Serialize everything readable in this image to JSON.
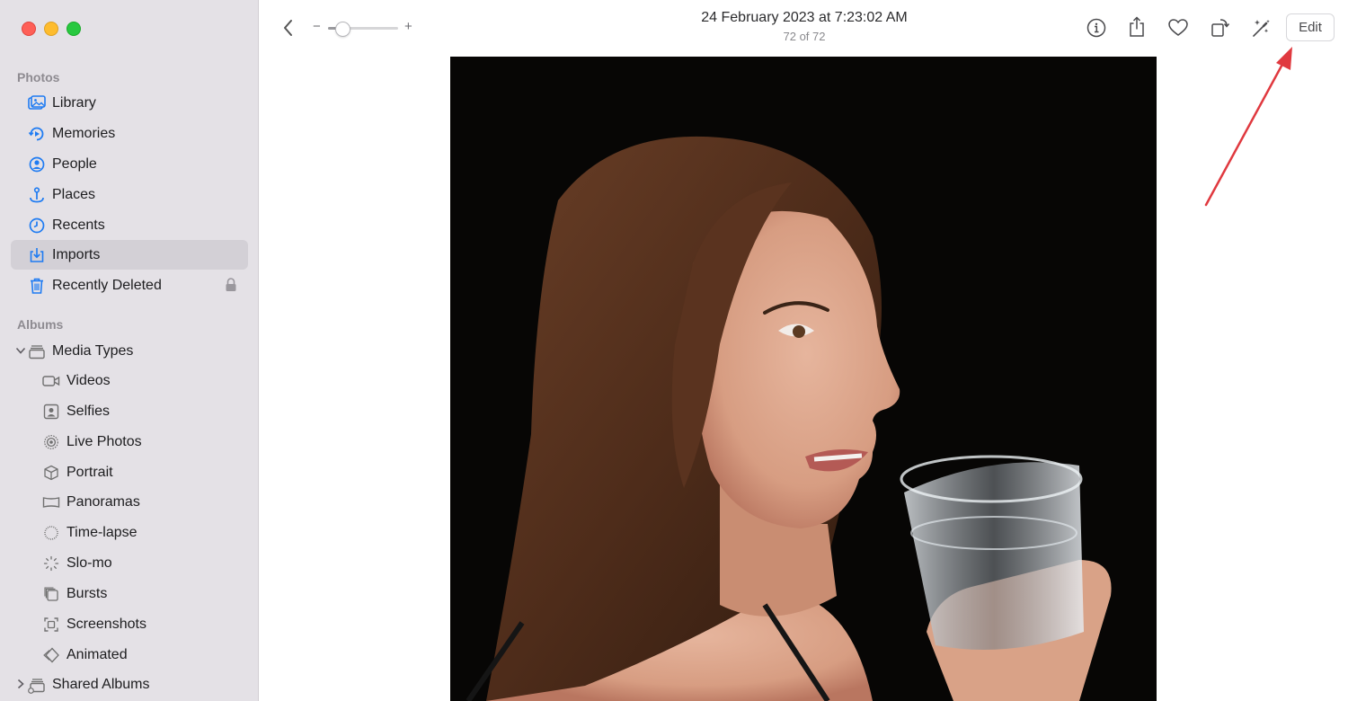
{
  "sidebar": {
    "photos_label": "Photos",
    "library": "Library",
    "memories": "Memories",
    "people": "People",
    "places": "Places",
    "recents": "Recents",
    "imports": "Imports",
    "recently_deleted": "Recently Deleted",
    "albums_label": "Albums",
    "media_types": "Media Types",
    "videos": "Videos",
    "selfies": "Selfies",
    "live_photos": "Live Photos",
    "portrait": "Portrait",
    "panoramas": "Panoramas",
    "time_lapse": "Time-lapse",
    "slo_mo": "Slo-mo",
    "bursts": "Bursts",
    "screenshots": "Screenshots",
    "animated": "Animated",
    "shared_albums": "Shared Albums",
    "selected_item": "Imports"
  },
  "toolbar": {
    "zoom_minus": "−",
    "zoom_plus": "+",
    "zoom_level": 0.2,
    "title": "24 February 2023 at 7:23:02 AM",
    "subtitle": "72 of 72",
    "edit_label": "Edit",
    "icons": [
      "back-icon",
      "info-icon",
      "share-icon",
      "favorite-icon",
      "rotate-icon",
      "auto-enhance-icon"
    ]
  },
  "colors": {
    "accent": "#1e7bf2",
    "sidebar_bg": "#e4e1e6",
    "selected_bg": "#d3d0d6",
    "annotation_arrow": "#e0393f"
  }
}
